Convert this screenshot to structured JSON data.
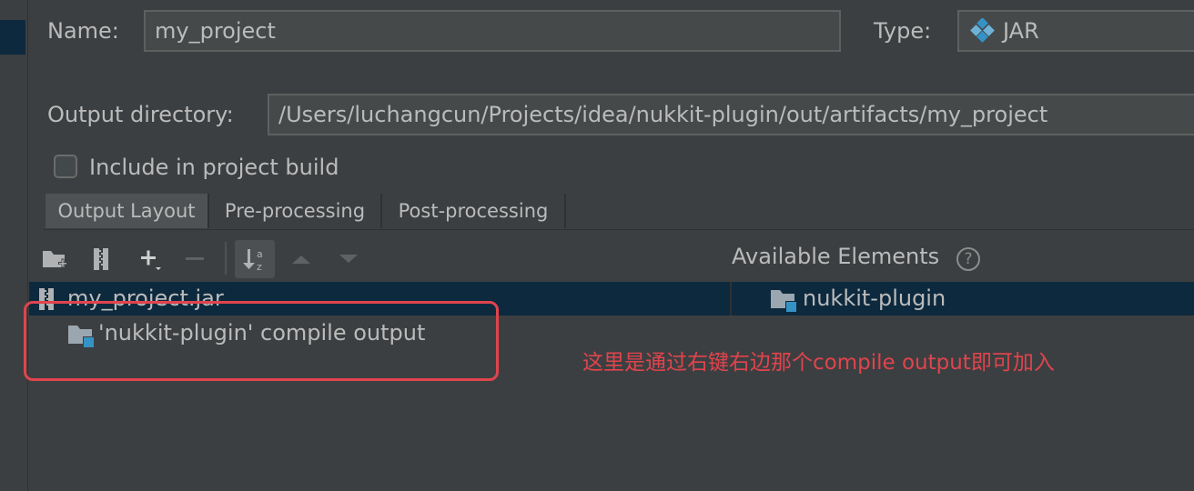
{
  "form": {
    "name_label": "Name:",
    "name_value": "my_project",
    "type_label": "Type:",
    "type_value": "JAR",
    "output_dir_label": "Output directory:",
    "output_dir_value": "/Users/luchangcun/Projects/idea/nukkit-plugin/out/artifacts/my_project",
    "include_label": "Include in project build",
    "include_checked": false
  },
  "tabs": [
    {
      "label": "Output Layout",
      "active": true
    },
    {
      "label": "Pre-processing",
      "active": false
    },
    {
      "label": "Post-processing",
      "active": false
    }
  ],
  "toolbar": {
    "icons": [
      "new-folder-icon",
      "archive-icon",
      "add-icon",
      "remove-icon",
      "sort-az-icon",
      "move-up-icon",
      "move-down-icon"
    ]
  },
  "available_elements": {
    "label": "Available Elements",
    "help_glyph": "?",
    "items": [
      {
        "label": "nukkit-plugin",
        "icon": "module-folder-icon"
      }
    ]
  },
  "layout_tree": {
    "root": {
      "label": "my_project.jar",
      "icon": "jar-icon"
    },
    "children": [
      {
        "label": "'nukkit-plugin' compile output",
        "icon": "module-folder-icon"
      }
    ]
  },
  "annotation": {
    "text": "这里是通过右键右边那个compile output即可加入",
    "color": "#e0444d"
  },
  "colors": {
    "background": "#3c3f41",
    "selection": "#0d293e",
    "accent_icon": "#3592c4"
  }
}
